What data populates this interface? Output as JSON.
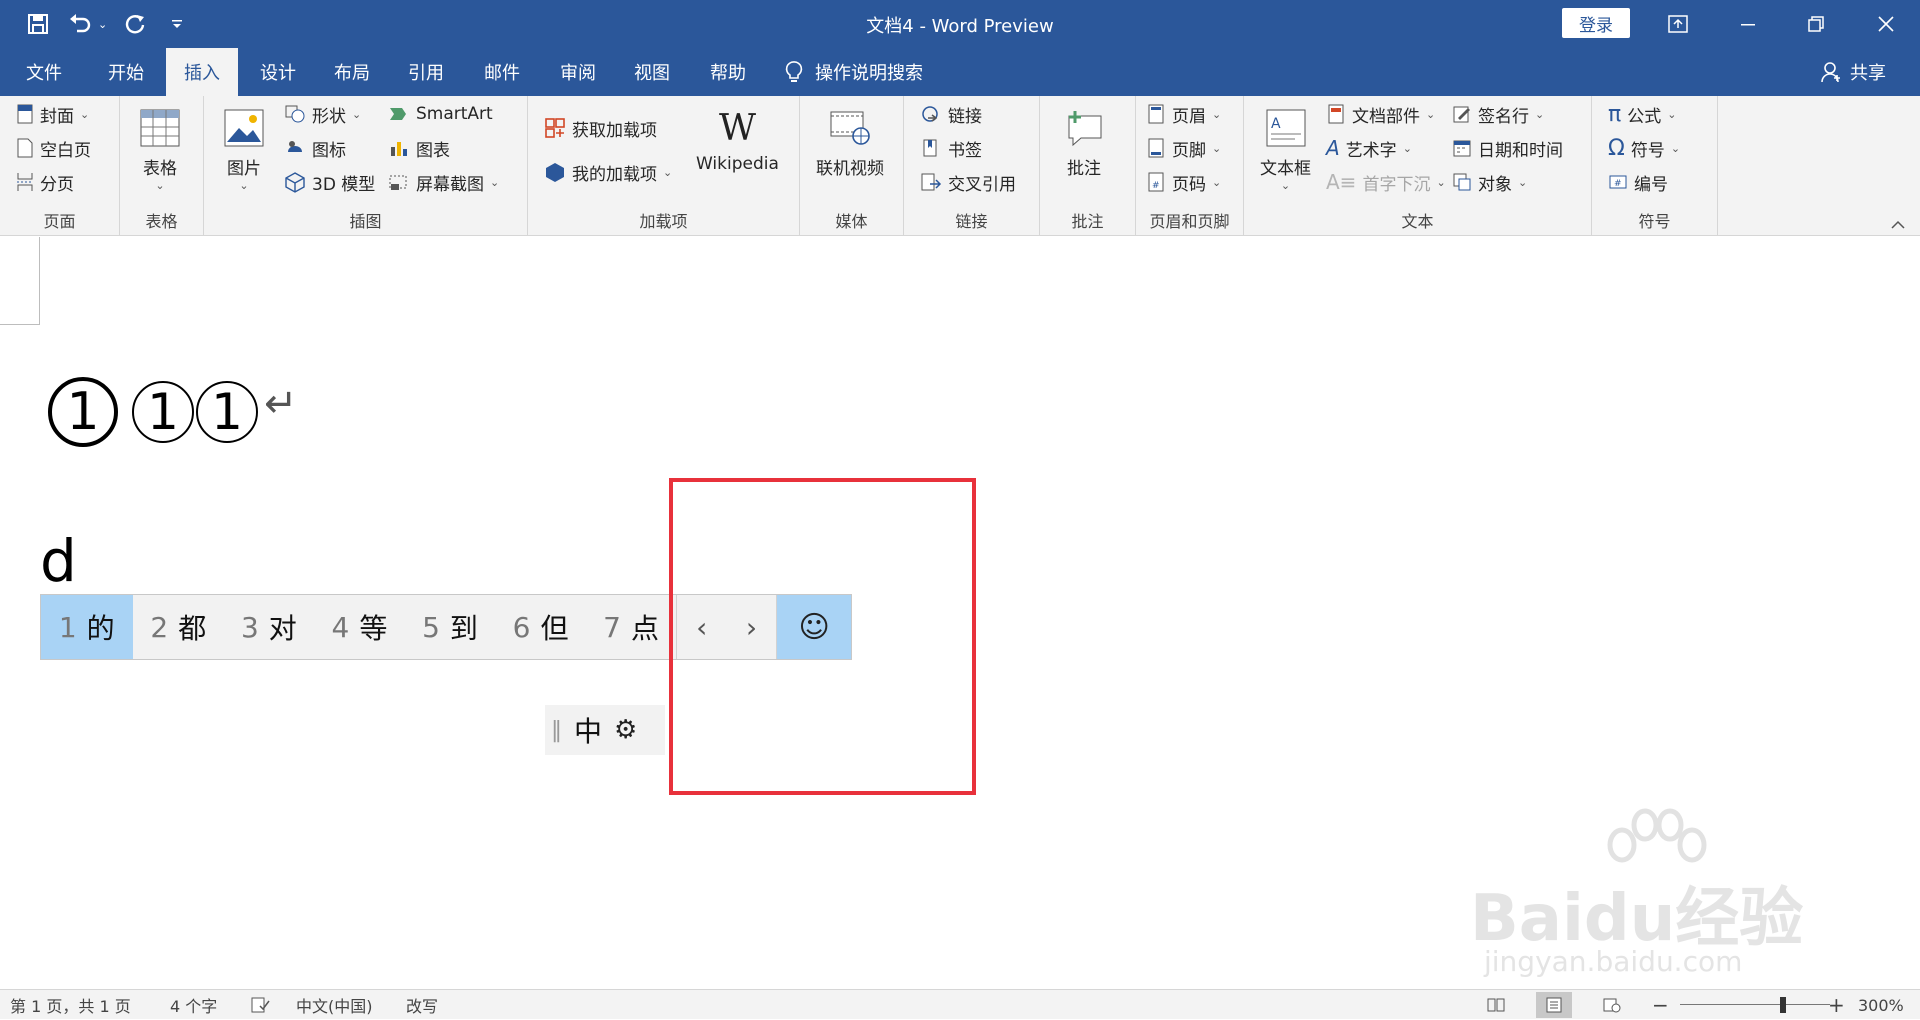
{
  "app": {
    "title": "文档4  -  Word Preview",
    "login_label": "登录"
  },
  "quick_access": {
    "icons": [
      "save-icon",
      "undo-icon",
      "redo-icon",
      "customize-icon"
    ]
  },
  "tabs": [
    {
      "label": "文件"
    },
    {
      "label": "开始"
    },
    {
      "label": "插入",
      "active": true
    },
    {
      "label": "设计"
    },
    {
      "label": "布局"
    },
    {
      "label": "引用"
    },
    {
      "label": "邮件"
    },
    {
      "label": "审阅"
    },
    {
      "label": "视图"
    },
    {
      "label": "帮助"
    }
  ],
  "tellme": {
    "label": "操作说明搜索"
  },
  "share": {
    "label": "共享"
  },
  "ribbon": {
    "pages": {
      "label": "页面",
      "cover": "封面",
      "blank": "空白页",
      "break": "分页"
    },
    "tables": {
      "label": "表格",
      "table": "表格"
    },
    "illustrations": {
      "label": "插图",
      "picture": "图片",
      "shapes": "形状",
      "icons": "图标",
      "model3d": "3D 模型",
      "smartart": "SmartArt",
      "chart": "图表",
      "screenshot": "屏幕截图"
    },
    "addins": {
      "label": "加载项",
      "get": "获取加载项",
      "my": "我的加载项",
      "wikipedia": "Wikipedia"
    },
    "media": {
      "label": "媒体",
      "video": "联机视频"
    },
    "links": {
      "label": "链接",
      "link": "链接",
      "bookmark": "书签",
      "crossref": "交叉引用"
    },
    "comments": {
      "label": "批注",
      "comment": "批注"
    },
    "headerfooter": {
      "label": "页眉和页脚",
      "header": "页眉",
      "footer": "页脚",
      "pagenum": "页码"
    },
    "text": {
      "label": "文本",
      "textbox": "文本框",
      "parts": "文档部件",
      "wordart": "艺术字",
      "dropcap": "首字下沉",
      "signature": "签名行",
      "datetime": "日期和时间",
      "object": "对象"
    },
    "symbols": {
      "label": "符号",
      "equation": "公式",
      "symbol": "符号",
      "number": "编号"
    }
  },
  "document": {
    "circled_1": "①",
    "circled_2": "1",
    "circled_3": "1",
    "return_mark": "↵",
    "typed": "d"
  },
  "ime": {
    "candidates": [
      {
        "n": "1",
        "h": "的",
        "selected": true
      },
      {
        "n": "2",
        "h": "都"
      },
      {
        "n": "3",
        "h": "对"
      },
      {
        "n": "4",
        "h": "等"
      },
      {
        "n": "5",
        "h": "到"
      },
      {
        "n": "6",
        "h": "但"
      },
      {
        "n": "7",
        "h": "点"
      }
    ],
    "prev": "‹",
    "next": "›",
    "emoji": "☺",
    "mode": "中"
  },
  "watermark": {
    "brand": "Baidu经验",
    "url": "jingyan.baidu.com"
  },
  "status": {
    "page": "第 1 页，共 1 页",
    "words": "4 个字",
    "lang": "中文(中国)",
    "mode": "改写",
    "zoom": "300%"
  },
  "colors": {
    "brand": "#2b579a",
    "highlight": "#a9d3f5",
    "annotation": "#e8313b"
  }
}
